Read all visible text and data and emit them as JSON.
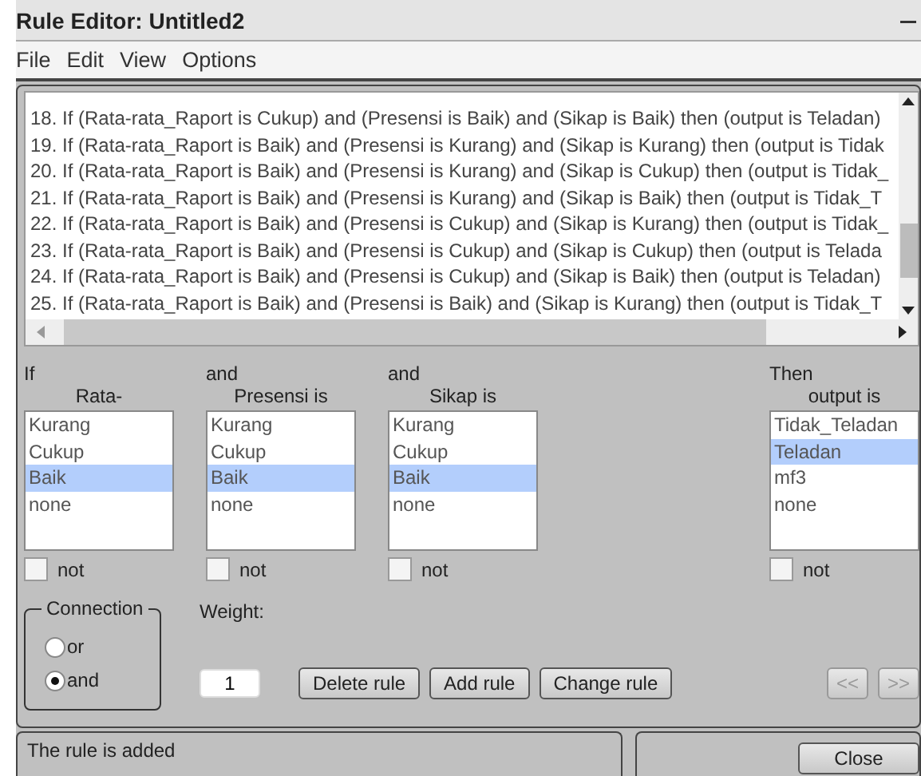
{
  "window": {
    "title": "Rule Editor: Untitled2"
  },
  "menu": [
    "File",
    "Edit",
    "View",
    "Options"
  ],
  "rules": [
    "18. If (Rata-rata_Raport is Cukup) and (Presensi is Baik) and (Sikap is Baik) then (output is Teladan)",
    "19. If (Rata-rata_Raport is Baik) and (Presensi is Kurang) and (Sikap is Kurang) then (output is Tidak",
    "20. If (Rata-rata_Raport is Baik) and (Presensi is Kurang) and (Sikap is Cukup) then (output is Tidak_",
    "21. If (Rata-rata_Raport is Baik) and (Presensi is Kurang) and (Sikap is Baik) then (output is Tidak_T",
    "22. If (Rata-rata_Raport is Baik) and (Presensi is Cukup) and (Sikap is Kurang) then (output is Tidak_",
    "23. If (Rata-rata_Raport is Baik) and (Presensi is Cukup) and (Sikap is Cukup) then (output is Telada",
    "24. If (Rata-rata_Raport is Baik) and (Presensi is Cukup) and (Sikap is Baik) then (output is Teladan)",
    "25. If (Rata-rata_Raport is Baik) and (Presensi is Baik) and (Sikap is Kurang) then (output is Tidak_T"
  ],
  "columns": [
    {
      "connector": "If",
      "label": "Rata-",
      "not": false,
      "not_label": "not",
      "items": [
        {
          "label": "Kurang",
          "selected": false
        },
        {
          "label": "Cukup",
          "selected": false
        },
        {
          "label": "Baik",
          "selected": true
        },
        {
          "label": "none",
          "selected": false
        }
      ]
    },
    {
      "connector": "and",
      "label": "Presensi is",
      "not": false,
      "not_label": "not",
      "items": [
        {
          "label": "Kurang",
          "selected": false
        },
        {
          "label": "Cukup",
          "selected": false
        },
        {
          "label": "Baik",
          "selected": true
        },
        {
          "label": "none",
          "selected": false
        }
      ]
    },
    {
      "connector": "and",
      "label": "Sikap is",
      "not": false,
      "not_label": "not",
      "items": [
        {
          "label": "Kurang",
          "selected": false
        },
        {
          "label": "Cukup",
          "selected": false
        },
        {
          "label": "Baik",
          "selected": true
        },
        {
          "label": "none",
          "selected": false
        }
      ]
    },
    {
      "connector": "Then",
      "label": "output is",
      "not": false,
      "not_label": "not",
      "items": [
        {
          "label": "Tidak_Teladan",
          "selected": false
        },
        {
          "label": "Teladan",
          "selected": true
        },
        {
          "label": "mf3",
          "selected": false
        },
        {
          "label": "none",
          "selected": false
        }
      ]
    }
  ],
  "connection": {
    "label": "Connection",
    "options": [
      {
        "label": "or",
        "selected": false
      },
      {
        "label": "and",
        "selected": true
      }
    ]
  },
  "weight": {
    "label": "Weight:",
    "value": "1"
  },
  "buttons": [
    {
      "label": "Delete rule",
      "disabled": false
    },
    {
      "label": "Add rule",
      "disabled": false
    },
    {
      "label": "Change rule",
      "disabled": false
    }
  ],
  "nav_buttons": [
    {
      "label": "<<",
      "disabled": true
    },
    {
      "label": ">>",
      "disabled": true
    }
  ],
  "status": "The rule is added",
  "close_button": "Close"
}
